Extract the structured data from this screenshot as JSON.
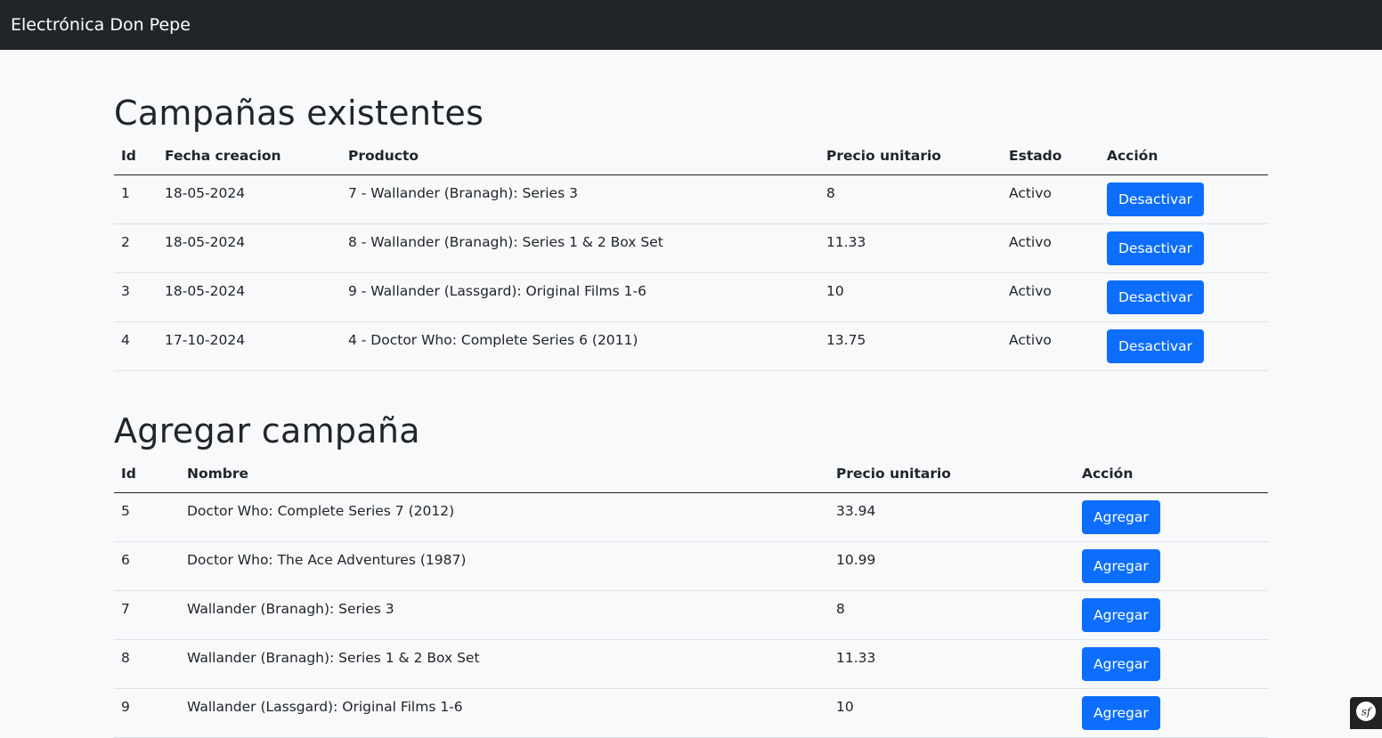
{
  "navbar": {
    "brand": "Electrónica Don Pepe"
  },
  "existing": {
    "title": "Campañas existentes",
    "columns": [
      "Id",
      "Fecha creacion",
      "Producto",
      "Precio unitario",
      "Estado",
      "Acción"
    ],
    "rows": [
      {
        "id": "1",
        "date": "18-05-2024",
        "product": "7 - Wallander (Branagh): Series 3",
        "price": "8",
        "status": "Activo",
        "action": "Desactivar"
      },
      {
        "id": "2",
        "date": "18-05-2024",
        "product": "8 - Wallander (Branagh): Series 1 & 2 Box Set",
        "price": "11.33",
        "status": "Activo",
        "action": "Desactivar"
      },
      {
        "id": "3",
        "date": "18-05-2024",
        "product": "9 - Wallander (Lassgard): Original Films 1-6",
        "price": "10",
        "status": "Activo",
        "action": "Desactivar"
      },
      {
        "id": "4",
        "date": "17-10-2024",
        "product": "4 - Doctor Who: Complete Series 6 (2011)",
        "price": "13.75",
        "status": "Activo",
        "action": "Desactivar"
      }
    ]
  },
  "add": {
    "title": "Agregar campaña",
    "columns": [
      "Id",
      "Nombre",
      "Precio unitario",
      "Acción"
    ],
    "rows": [
      {
        "id": "5",
        "name": "Doctor Who: Complete Series 7 (2012)",
        "price": "33.94",
        "action": "Agregar"
      },
      {
        "id": "6",
        "name": "Doctor Who: The Ace Adventures (1987)",
        "price": "10.99",
        "action": "Agregar"
      },
      {
        "id": "7",
        "name": "Wallander (Branagh): Series 3",
        "price": "8",
        "action": "Agregar"
      },
      {
        "id": "8",
        "name": "Wallander (Branagh): Series 1 & 2 Box Set",
        "price": "11.33",
        "action": "Agregar"
      },
      {
        "id": "9",
        "name": "Wallander (Lassgard): Original Films 1-6",
        "price": "10",
        "action": "Agregar"
      }
    ]
  },
  "colors": {
    "primary": "#0d6efd",
    "navbar": "#212529",
    "background": "#f8f9fa"
  },
  "icons": {
    "debug_toolbar": "symfony-icon"
  }
}
